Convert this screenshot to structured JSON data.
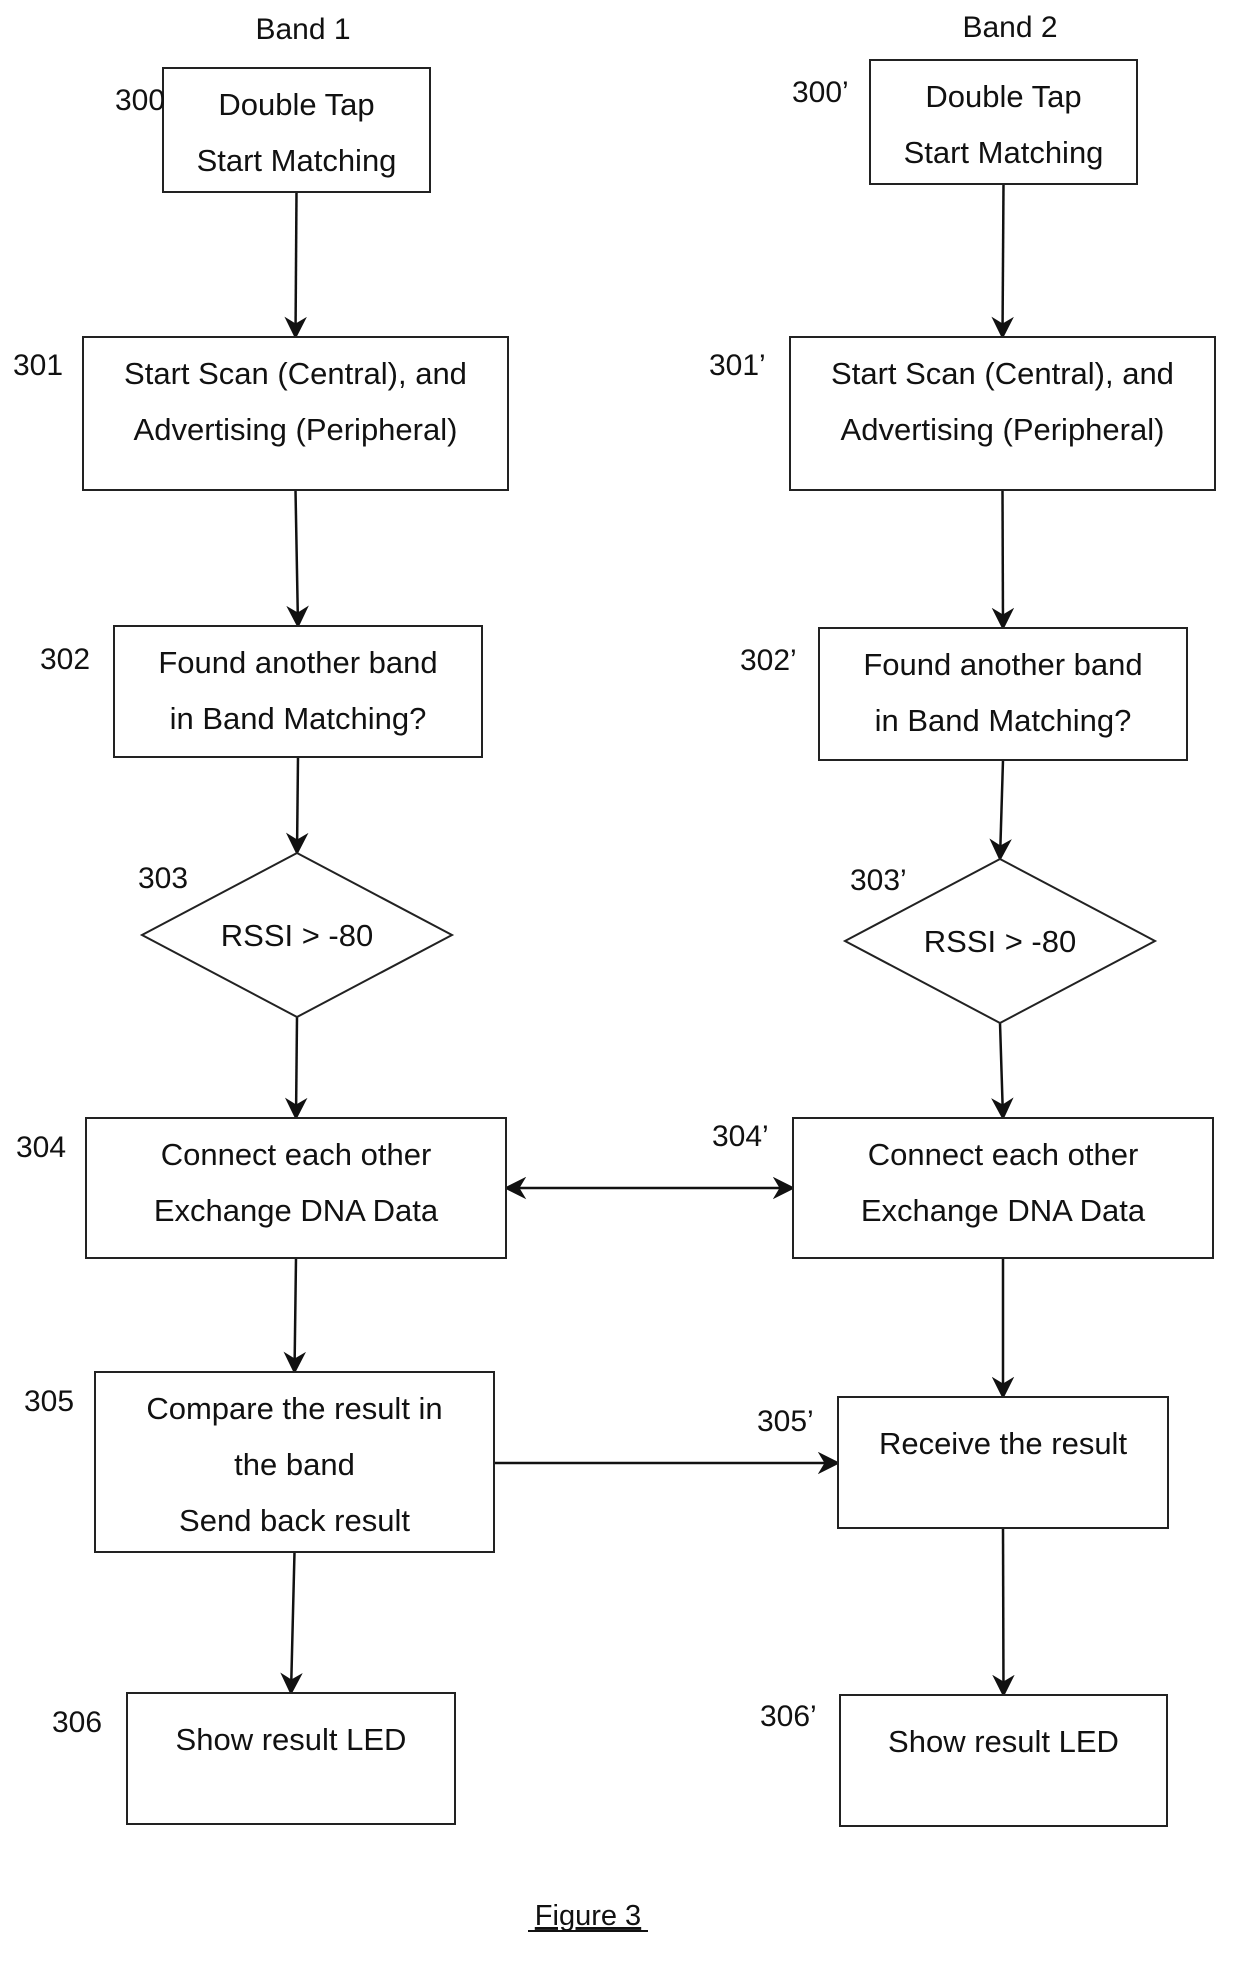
{
  "bands": [
    {
      "id": "band1",
      "label": "Band 1"
    },
    {
      "id": "band2",
      "label": "Band 2"
    }
  ],
  "nodes": [
    {
      "id": "300",
      "ref": "300",
      "shape": "rect",
      "lines": [
        "Double Tap",
        "Start Matching"
      ]
    },
    {
      "id": "301",
      "ref": "301",
      "shape": "rect",
      "lines": [
        "Start Scan (Central), and",
        "Advertising (Peripheral)"
      ]
    },
    {
      "id": "302",
      "ref": "302",
      "shape": "rect",
      "lines": [
        "Found another band",
        "in Band Matching?"
      ]
    },
    {
      "id": "303",
      "ref": "303",
      "shape": "diamond",
      "lines": [
        "RSSI > -80"
      ]
    },
    {
      "id": "304",
      "ref": "304",
      "shape": "rect",
      "lines": [
        "Connect each other",
        "Exchange DNA Data"
      ]
    },
    {
      "id": "305",
      "ref": "305",
      "shape": "rect",
      "lines": [
        "Compare the result in",
        "the band",
        "Send back result"
      ]
    },
    {
      "id": "306",
      "ref": "306",
      "shape": "rect",
      "lines": [
        "Show result LED"
      ]
    },
    {
      "id": "300p",
      "ref": "300’",
      "shape": "rect",
      "lines": [
        "Double Tap",
        "Start Matching"
      ]
    },
    {
      "id": "301p",
      "ref": "301’",
      "shape": "rect",
      "lines": [
        "Start Scan (Central), and",
        "Advertising (Peripheral)"
      ]
    },
    {
      "id": "302p",
      "ref": "302’",
      "shape": "rect",
      "lines": [
        "Found another band",
        "in Band Matching?"
      ]
    },
    {
      "id": "303p",
      "ref": "303’",
      "shape": "diamond",
      "lines": [
        "RSSI > -80"
      ]
    },
    {
      "id": "304p",
      "ref": "304’",
      "shape": "rect",
      "lines": [
        "Connect each other",
        "Exchange DNA Data"
      ]
    },
    {
      "id": "305p",
      "ref": "305’",
      "shape": "rect",
      "lines": [
        "Receive the result"
      ]
    },
    {
      "id": "306p",
      "ref": "306’",
      "shape": "rect",
      "lines": [
        "Show result LED"
      ]
    }
  ],
  "edges": [
    {
      "from": "300",
      "to": "301",
      "direction": "forward"
    },
    {
      "from": "301",
      "to": "302",
      "direction": "forward"
    },
    {
      "from": "302",
      "to": "303",
      "direction": "forward"
    },
    {
      "from": "303",
      "to": "304",
      "direction": "forward"
    },
    {
      "from": "304",
      "to": "305",
      "direction": "forward"
    },
    {
      "from": "305",
      "to": "306",
      "direction": "forward"
    },
    {
      "from": "300p",
      "to": "301p",
      "direction": "forward"
    },
    {
      "from": "301p",
      "to": "302p",
      "direction": "forward"
    },
    {
      "from": "302p",
      "to": "303p",
      "direction": "forward"
    },
    {
      "from": "303p",
      "to": "304p",
      "direction": "forward"
    },
    {
      "from": "304p",
      "to": "305p",
      "direction": "forward"
    },
    {
      "from": "305p",
      "to": "306p",
      "direction": "forward"
    },
    {
      "from": "304",
      "to": "304p",
      "direction": "both"
    },
    {
      "from": "305",
      "to": "305p",
      "direction": "forward"
    }
  ],
  "caption": "Figure 3"
}
